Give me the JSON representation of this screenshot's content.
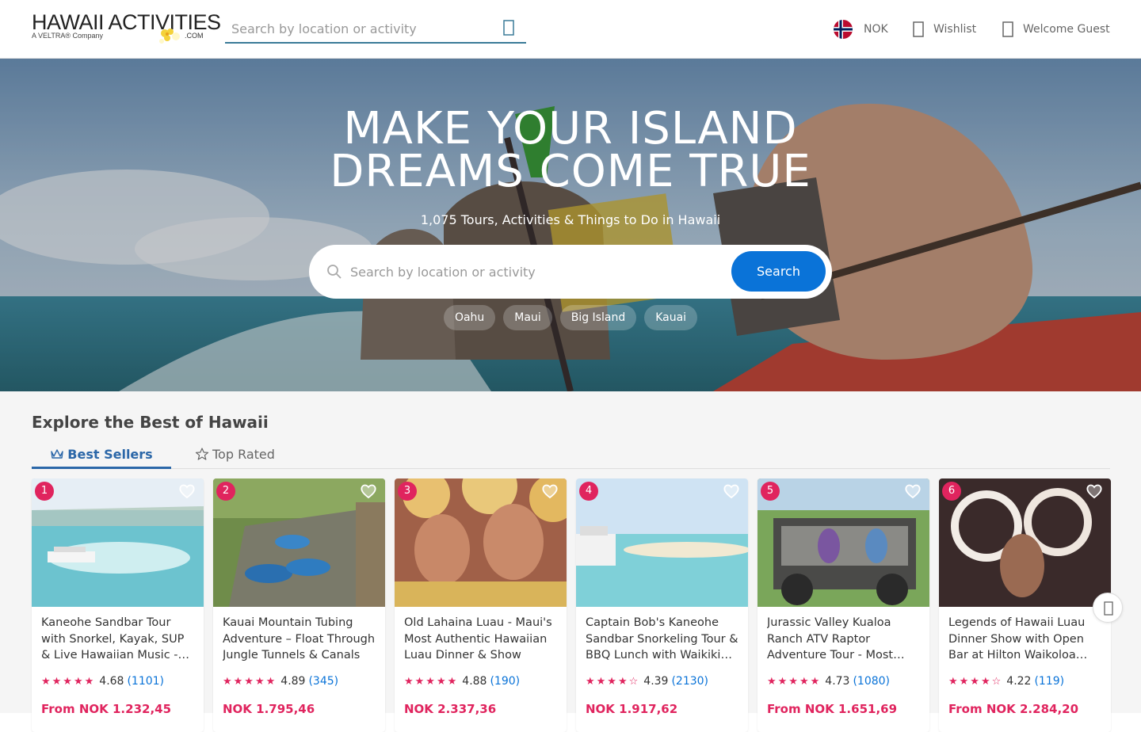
{
  "header": {
    "logo_main": "HAWAII ACTIVITIES",
    "logo_sub": "A VELTRA® Company",
    "logo_com": ".COM",
    "search_placeholder": "Search by location or activity",
    "currency": "NOK",
    "wishlist": "Wishlist",
    "account": "Welcome Guest"
  },
  "hero": {
    "title_line1": "MAKE YOUR ISLAND",
    "title_line2": "DREAMS COME TRUE",
    "subtitle": "1,075 Tours, Activities & Things to Do in Hawaii",
    "search_placeholder": "Search by location or activity",
    "search_button": "Search",
    "chips": [
      "Oahu",
      "Maui",
      "Big Island",
      "Kauai"
    ]
  },
  "explore": {
    "title": "Explore the Best of Hawaii",
    "tab_best": "Best Sellers",
    "tab_top": "Top Rated"
  },
  "cards": [
    {
      "rank": "1",
      "title": "Kaneohe Sandbar Tour with Snorkel, Kayak, SUP & Live Hawaiian Music - Kaneohe Bay",
      "stars": "★★★★★",
      "rating": "4.68",
      "count": "(1101)",
      "price": "From NOK 1.232,45"
    },
    {
      "rank": "2",
      "title": "Kauai Mountain Tubing Adventure – Float Through Jungle Tunnels & Canals",
      "stars": "★★★★★",
      "rating": "4.89",
      "count": "(345)",
      "price": "NOK 1.795,46"
    },
    {
      "rank": "3",
      "title": "Old Lahaina Luau - Maui's Most Authentic Hawaiian Luau Dinner & Show",
      "stars": "★★★★★",
      "rating": "4.88",
      "count": "(190)",
      "price": "NOK 2.337,36"
    },
    {
      "rank": "4",
      "title": "Captain Bob's Kaneohe Sandbar Snorkeling Tour & BBQ Lunch with Waikiki Pickup",
      "stars": "★★★★☆",
      "rating": "4.39",
      "count": "(2130)",
      "price": "NOK 1.917,62"
    },
    {
      "rank": "5",
      "title": "Jurassic Valley Kualoa Ranch ATV Raptor Adventure Tour - Most Popular",
      "stars": "★★★★★",
      "rating": "4.73",
      "count": "(1080)",
      "price": "From NOK 1.651,69"
    },
    {
      "rank": "6",
      "title": "Legends of Hawaii Luau Dinner Show with Open Bar at Hilton Waikoloa Village",
      "stars": "★★★★☆",
      "rating": "4.22",
      "count": "(119)",
      "price": "From NOK 2.284,20"
    }
  ],
  "colors": {
    "accent": "#e0245e",
    "link": "#0a73d8",
    "tab": "#2b67a8"
  }
}
